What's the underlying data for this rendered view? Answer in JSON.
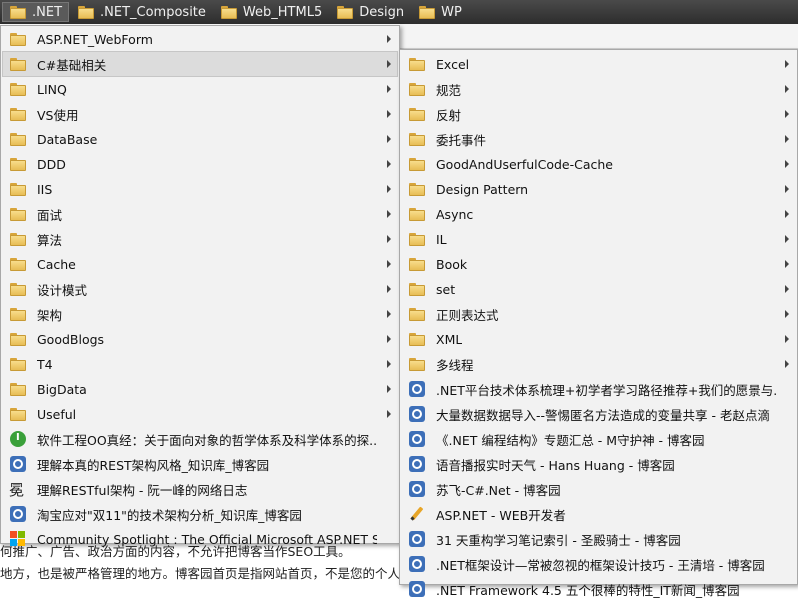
{
  "bookmarks_bar": [
    {
      "label": ".NET",
      "icon": "folder-icon",
      "active": true
    },
    {
      "label": ".NET_Composite",
      "icon": "folder-icon"
    },
    {
      "label": "Web_HTML5",
      "icon": "folder-icon"
    },
    {
      "label": "Design",
      "icon": "folder-icon"
    },
    {
      "label": "WP",
      "icon": "folder-icon"
    }
  ],
  "menu1": [
    {
      "label": "ASP.NET_WebForm",
      "icon": "folder-icon",
      "submenu": true
    },
    {
      "label": "C#基础相关",
      "icon": "folder-icon",
      "submenu": true,
      "selected": true
    },
    {
      "label": "LINQ",
      "icon": "folder-icon",
      "submenu": true
    },
    {
      "label": "VS使用",
      "icon": "folder-icon",
      "submenu": true
    },
    {
      "label": "DataBase",
      "icon": "folder-icon",
      "submenu": true
    },
    {
      "label": "DDD",
      "icon": "folder-icon",
      "submenu": true
    },
    {
      "label": "IIS",
      "icon": "folder-icon",
      "submenu": true
    },
    {
      "label": "面试",
      "icon": "folder-icon",
      "submenu": true
    },
    {
      "label": "算法",
      "icon": "folder-icon",
      "submenu": true
    },
    {
      "label": "Cache",
      "icon": "folder-icon",
      "submenu": true
    },
    {
      "label": "设计模式",
      "icon": "folder-icon",
      "submenu": true
    },
    {
      "label": "架构",
      "icon": "folder-icon",
      "submenu": true
    },
    {
      "label": "GoodBlogs",
      "icon": "folder-icon",
      "submenu": true
    },
    {
      "label": "T4",
      "icon": "folder-icon",
      "submenu": true
    },
    {
      "label": "BigData",
      "icon": "folder-icon",
      "submenu": true
    },
    {
      "label": "Useful",
      "icon": "folder-icon",
      "submenu": true
    },
    {
      "label": "软件工程OO真经：关于面向对象的哲学体系及科学体系的探...",
      "icon": "green-site-icon"
    },
    {
      "label": "理解本真的REST架构风格_知识库_博客园",
      "icon": "cnblogs-icon"
    },
    {
      "label": "理解RESTful架构 - 阮一峰的网络日志",
      "icon": "script-site-icon"
    },
    {
      "label": "淘宝应对\"双11\"的技术架构分析_知识库_博客园",
      "icon": "cnblogs-icon"
    },
    {
      "label": "Community Spotlight : The Official Microsoft ASP.NET Site",
      "icon": "microsoft-icon"
    }
  ],
  "menu2": [
    {
      "label": "Excel",
      "icon": "folder-icon",
      "submenu": true
    },
    {
      "label": "规范",
      "icon": "folder-icon",
      "submenu": true
    },
    {
      "label": "反射",
      "icon": "folder-icon",
      "submenu": true
    },
    {
      "label": "委托事件",
      "icon": "folder-icon",
      "submenu": true
    },
    {
      "label": "GoodAndUserfulCode-Cache",
      "icon": "folder-icon",
      "submenu": true
    },
    {
      "label": "Design Pattern",
      "icon": "folder-icon",
      "submenu": true
    },
    {
      "label": "Async",
      "icon": "folder-icon",
      "submenu": true
    },
    {
      "label": "IL",
      "icon": "folder-icon",
      "submenu": true
    },
    {
      "label": "Book",
      "icon": "folder-icon",
      "submenu": true
    },
    {
      "label": "set",
      "icon": "folder-icon",
      "submenu": true
    },
    {
      "label": "正则表达式",
      "icon": "folder-icon",
      "submenu": true
    },
    {
      "label": "XML",
      "icon": "folder-icon",
      "submenu": true
    },
    {
      "label": "多线程",
      "icon": "folder-icon",
      "submenu": true
    },
    {
      "label": ".NET平台技术体系梳理+初学者学习路径推荐+我们的愿景与...",
      "icon": "cnblogs-icon"
    },
    {
      "label": "大量数据数据导入--警惕匿名方法造成的变量共享 - 老赵点滴",
      "icon": "cnblogs-icon"
    },
    {
      "label": "《.NET 编程结构》专题汇总 - M守护神 - 博客园",
      "icon": "cnblogs-icon"
    },
    {
      "label": "语音播报实时天气 - Hans Huang - 博客园",
      "icon": "cnblogs-icon"
    },
    {
      "label": "苏飞-C#.Net - 博客园",
      "icon": "cnblogs-icon"
    },
    {
      "label": "ASP.NET - WEB开发者",
      "icon": "pencil-icon"
    },
    {
      "label": "31 天重构学习笔记索引 - 圣殿骑士 - 博客园",
      "icon": "cnblogs-icon"
    },
    {
      "label": ".NET框架设计—常被忽视的框架设计技巧 - 王清培 - 博客园",
      "icon": "cnblogs-icon"
    },
    {
      "label": ".NET Framework 4.5 五个很棒的特性_IT新闻_博客园",
      "icon": "cnblogs-icon"
    }
  ],
  "background_page": {
    "line1": "何推广、广告、政治方面的内容，不允许把博客当作SEO工具。",
    "line2": "地方，也是被严格管理的地方。博客园首页是指网站首页，不是您的个人博客"
  }
}
